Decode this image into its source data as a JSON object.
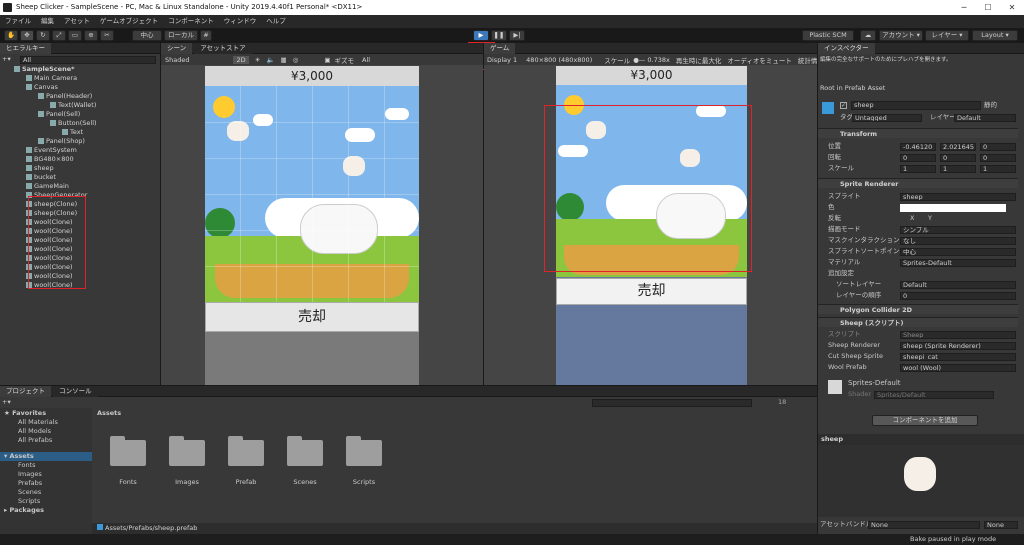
{
  "titlebar": {
    "title": "Sheep Clicker - SampleScene - PC, Mac & Linux Standalone - Unity 2019.4.40f1 Personal* <DX11>"
  },
  "menu": [
    "ファイル",
    "編集",
    "アセット",
    "ゲームオブジェクト",
    "コンポーネント",
    "ウィンドウ",
    "ヘルプ"
  ],
  "toolbar": {
    "pivot": "中心",
    "space": "ローカル",
    "plastic": "Plastic SCM",
    "account": "アカウント",
    "layers": "レイヤー",
    "layout": "Layout"
  },
  "hierarchy": {
    "tab": "ヒエラルキー",
    "search": "All",
    "items": [
      {
        "label": "SampleScene*"
      },
      {
        "label": "Main Camera"
      },
      {
        "label": "Canvas"
      },
      {
        "label": "Panel(Header)"
      },
      {
        "label": "Text(Wallet)"
      },
      {
        "label": "Panel(Sell)"
      },
      {
        "label": "Button(Sell)"
      },
      {
        "label": "Text"
      },
      {
        "label": "Panel(Shop)"
      },
      {
        "label": "EventSystem"
      },
      {
        "label": "BG480×800"
      },
      {
        "label": "sheep"
      },
      {
        "label": "bucket"
      },
      {
        "label": "GameMain"
      },
      {
        "label": "SheepGenerator"
      },
      {
        "label": "sheep(Clone)"
      },
      {
        "label": "sheep(Clone)"
      },
      {
        "label": "wool(Clone)"
      },
      {
        "label": "wool(Clone)"
      },
      {
        "label": "wool(Clone)"
      },
      {
        "label": "wool(Clone)"
      },
      {
        "label": "wool(Clone)"
      },
      {
        "label": "wool(Clone)"
      },
      {
        "label": "wool(Clone)"
      },
      {
        "label": "wool(Clone)"
      }
    ]
  },
  "scene": {
    "tabs": [
      "シーン",
      "アセットストア"
    ],
    "shading": "Shaded",
    "mode2d": "2D",
    "gizmos": "ギズモ",
    "search": "All",
    "wallet": "¥3,000",
    "sell": "売却"
  },
  "game": {
    "tab": "ゲーム",
    "display": "Display 1",
    "resolution": "480×800 (480x800)",
    "scale_label": "スケール",
    "scale_value": "0.738x",
    "maximize": "再生時に最大化",
    "mute": "オーディオをミュート",
    "stats": "統計情報",
    "wallet": "¥3,000",
    "sell": "売却"
  },
  "inspector": {
    "tab": "インスペクター",
    "notice": "編集の完全なサポートのためにプレハブを開きます。",
    "root": "Root in Prefab Asset",
    "name": "sheep",
    "static": "静的",
    "tag_label": "タグ",
    "tag": "Untagged",
    "layer_label": "レイヤー",
    "layer": "Default",
    "transform": {
      "title": "Transform",
      "pos_label": "位置",
      "rot_label": "回転",
      "scale_label": "スケール",
      "pos": [
        "-0.46120",
        "2.021645",
        "0"
      ],
      "rot": [
        "0",
        "0",
        "0"
      ],
      "scale": [
        "1",
        "1",
        "1"
      ]
    },
    "sprite_renderer": {
      "title": "Sprite Renderer",
      "sprite_label": "スプライト",
      "sprite": "sheep",
      "color_label": "色",
      "flip_label": "反転",
      "flip_x": "X",
      "flip_y": "Y",
      "draw_label": "描画モード",
      "draw": "シンプル",
      "mask_label": "マスクインタラクション",
      "mask": "なし",
      "sort_label": "スプライトソートポイント",
      "sort": "中心",
      "mat_label": "マテリアル",
      "mat": "Sprites-Default",
      "extra": "追加設定",
      "sortlayer_label": "ソートレイヤー",
      "sortlayer": "Default",
      "order_label": "レイヤーの順序",
      "order": "0"
    },
    "collider": {
      "title": "Polygon Collider 2D"
    },
    "script": {
      "title": "Sheep (スクリプト)",
      "script_label": "スクリプト",
      "script": "Sheep",
      "sr_label": "Sheep Renderer",
      "sr": "sheep (Sprite Renderer)",
      "cut_label": "Cut Sheep Sprite",
      "cut": "sheepi_cat",
      "wool_label": "Wool Prefab",
      "wool": "wool (Wool)"
    },
    "material": {
      "name": "Sprites-Default",
      "shader_label": "Shader",
      "shader": "Sprites/Default"
    },
    "add_component": "コンポーネントを追加",
    "preview_title": "sheep",
    "asset_bundle_label": "アセットバンドル",
    "asset_bundle": "None",
    "asset_bundle_variant": "None"
  },
  "project": {
    "tabs": [
      "プロジェクト",
      "コンソール"
    ],
    "favorites": {
      "title": "Favorites",
      "items": [
        "All Materials",
        "All Models",
        "All Prefabs"
      ]
    },
    "assets_tree": {
      "title": "Assets",
      "items": [
        "Fonts",
        "Images",
        "Prefabs",
        "Scenes",
        "Scripts"
      ]
    },
    "packages": "Packages",
    "breadcrumb": "Assets",
    "folders": [
      "Fonts",
      "Images",
      "Prefab",
      "Scenes",
      "Scripts"
    ],
    "count": "18",
    "path": "Assets/Prefabs/sheep.prefab"
  },
  "status": {
    "text": "Bake paused in play mode"
  },
  "colors": {
    "accent": "#3a79bb",
    "highlight": "#e0232b",
    "sky": "#7fb6ec",
    "grass": "#8cc63f"
  }
}
